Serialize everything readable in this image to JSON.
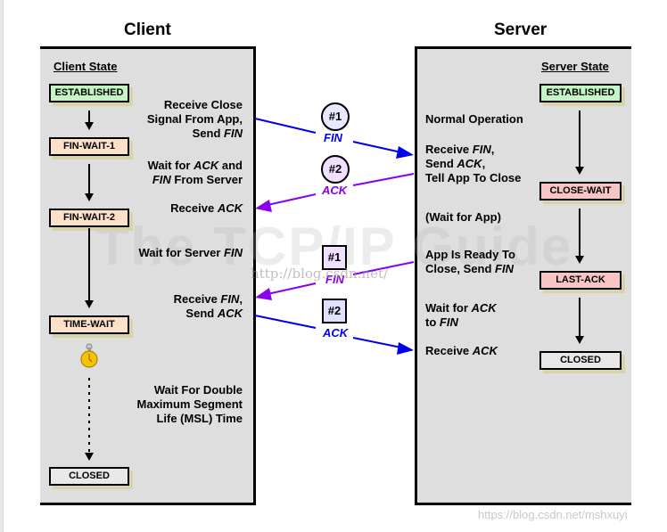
{
  "client": {
    "title": "Client",
    "state_header": "Client State",
    "states": [
      "ESTABLISHED",
      "FIN-WAIT-1",
      "FIN-WAIT-2",
      "TIME-WAIT",
      "CLOSED"
    ],
    "descriptions": {
      "d1": [
        "Receive Close",
        "Signal From App,",
        "Send ",
        "FIN"
      ],
      "d2": [
        "Wait for ",
        "ACK",
        " and",
        "FIN",
        " From Server"
      ],
      "d3": [
        "Receive ",
        "ACK"
      ],
      "d4": [
        "Wait for Server ",
        "FIN"
      ],
      "d5": [
        "Receive ",
        "FIN",
        ",",
        "Send ",
        "ACK"
      ],
      "d6": [
        "Wait For Double",
        "Maximum Segment",
        "Life (MSL) Time"
      ]
    },
    "timer_icon": "stopwatch-icon"
  },
  "server": {
    "title": "Server",
    "state_header": "Server State",
    "states": [
      "ESTABLISHED",
      "CLOSE-WAIT",
      "LAST-ACK",
      "CLOSED"
    ],
    "descriptions": {
      "d1": "Normal Operation",
      "d2": [
        "Receive ",
        "FIN",
        ",",
        "Send ",
        "ACK",
        ",",
        "Tell App To Close"
      ],
      "d3": "(Wait for App)",
      "d4": [
        "App Is Ready To",
        "Close, Send ",
        "FIN"
      ],
      "d5": [
        "Wait for ",
        "ACK",
        "to ",
        "FIN"
      ],
      "d6": [
        "Receive ",
        "ACK"
      ]
    }
  },
  "segments": [
    {
      "id": "#1",
      "label": "FIN",
      "direction": "client-to-server",
      "shape": "circle",
      "color": "#0000ee",
      "fill": "#e8e8ff"
    },
    {
      "id": "#2",
      "label": "ACK",
      "direction": "server-to-client",
      "shape": "circle",
      "color": "#8800ee",
      "fill": "#efe0ff"
    },
    {
      "id": "#1",
      "label": "FIN",
      "direction": "server-to-client",
      "shape": "square",
      "color": "#8800ee",
      "fill": "#efe0ff"
    },
    {
      "id": "#2",
      "label": "ACK",
      "direction": "client-to-server",
      "shape": "square",
      "color": "#0000ee",
      "fill": "#e0e0ff"
    }
  ],
  "colors": {
    "fin_arrow": "#0000ee",
    "ack_arrow": "#8800ee",
    "panel_bg": "#dedede",
    "state_established": "#c4f5c4",
    "state_client_wait": "#fde0c8",
    "state_server_wait": "#f9c4c4",
    "state_closed": "#e8e8e8"
  },
  "watermarks": {
    "big": "The TCP/IP Guide",
    "url": "http://blog.csdn.net/",
    "footer": "https://blog.csdn.net/mshxuyi"
  }
}
